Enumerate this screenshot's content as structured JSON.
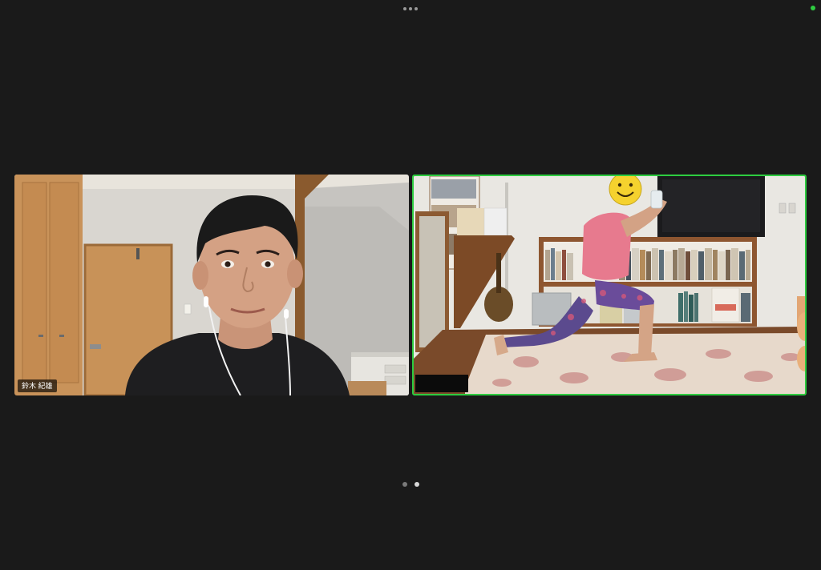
{
  "top_bar": {
    "more_icon": "more-horizontal-icon",
    "status_color": "#2ecc40"
  },
  "participants": [
    {
      "name": "鈴木 紀雄",
      "active_speaker": false
    },
    {
      "name": "",
      "active_speaker": true,
      "border_color": "#2ecc40"
    }
  ],
  "pager": {
    "page_count": 2,
    "current_page": 2,
    "active_color": "#d8d8d8",
    "inactive_color": "#7a7a7a"
  }
}
